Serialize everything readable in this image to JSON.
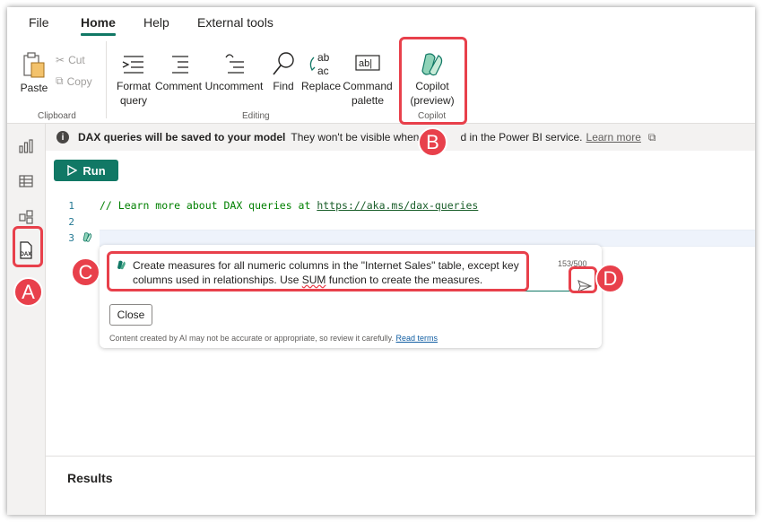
{
  "menu": {
    "file": "File",
    "home": "Home",
    "help": "Help",
    "external_tools": "External tools"
  },
  "ribbon": {
    "paste": "Paste",
    "cut": "Cut",
    "copy": "Copy",
    "clipboard_group": "Clipboard",
    "format_query_1": "Format",
    "format_query_2": "query",
    "comment": "Comment",
    "uncomment": "Uncomment",
    "find": "Find",
    "replace": "Replace",
    "command_1": "Command",
    "command_2": "palette",
    "editing_group": "Editing",
    "copilot_1": "Copilot",
    "copilot_2": "(preview)",
    "copilot_group": "Copilot"
  },
  "infobar": {
    "title": "DAX queries will be saved to your model",
    "message_part1": "They won't be visible when p",
    "message_part2": "d in the Power BI service.",
    "link": "Learn more"
  },
  "editor": {
    "run_label": "Run",
    "line_numbers": [
      "1",
      "2",
      "3"
    ],
    "comment_prefix": "// Learn more about DAX queries at ",
    "comment_url": "https://aka.ms/dax-queries"
  },
  "copilot": {
    "prompt_line1": "Create measures for all numeric columns in the \"Internet Sales\" table, except key",
    "prompt_line2a": "columns used in relationships. Use ",
    "prompt_sum": "SUM",
    "prompt_line2b": " function to create the measures.",
    "counter": "153/500",
    "close_label": "Close",
    "disclaimer": "Content created by AI may not be accurate or appropriate, so review it carefully.",
    "read_terms": "Read terms"
  },
  "results_label": "Results",
  "callouts": {
    "a": "A",
    "b": "B",
    "c": "C",
    "d": "D"
  },
  "colors": {
    "accent": "#117865",
    "callout": "#e8404b"
  }
}
